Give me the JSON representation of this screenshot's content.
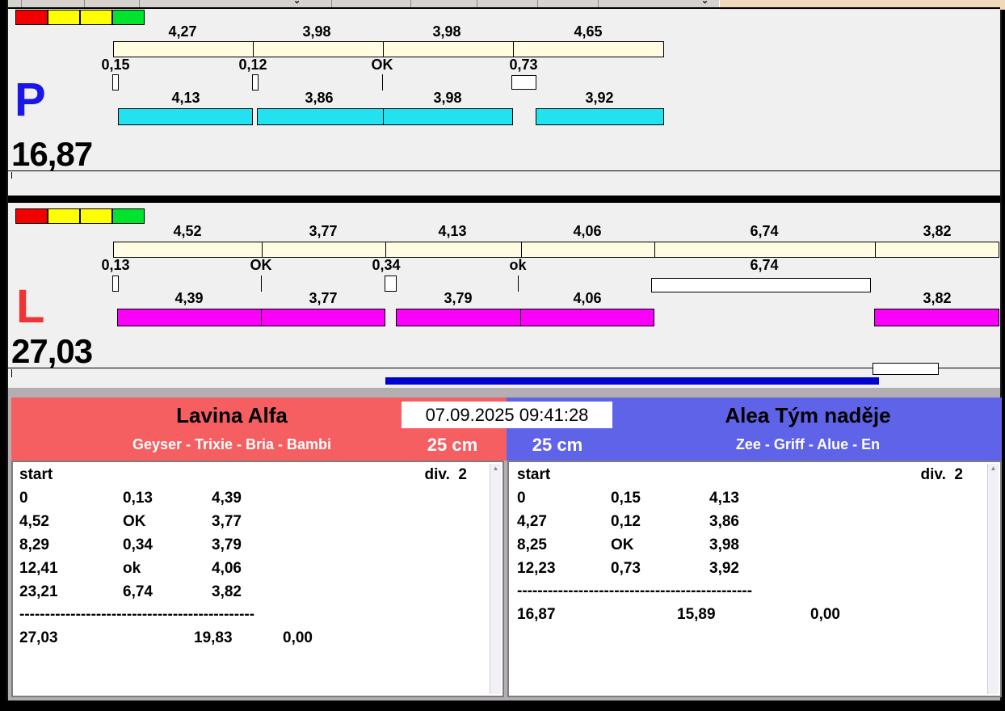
{
  "clock": "07.09.2025 09:41:28",
  "lane_p": {
    "letter": "P",
    "total": "16,87",
    "splits": [
      "4,27",
      "3,98",
      "3,98",
      "4,65"
    ],
    "crossings": [
      "0,15",
      "0,12",
      "OK",
      "0,73"
    ],
    "runs": [
      "4,13",
      "3,86",
      "3,98",
      "3,92"
    ]
  },
  "lane_l": {
    "letter": "L",
    "total": "27,03",
    "splits": [
      "4,52",
      "3,77",
      "4,13",
      "4,06",
      "6,74",
      "3,82"
    ],
    "crossings": [
      "0,13",
      "OK",
      "0,34",
      "ok",
      "6,74"
    ],
    "runs": [
      "4,39",
      "3,77",
      "3,79",
      "4,06",
      "3,82"
    ]
  },
  "left_panel": {
    "team": "Lavina Alfa",
    "dogs": "Geyser - Trixie - Bria - Bambi",
    "height": "25 cm",
    "header_left": "start",
    "header_right": "div.  2",
    "rows": [
      [
        "0",
        "0,13",
        "4,39"
      ],
      [
        "4,52",
        "OK",
        "3,77"
      ],
      [
        "8,29",
        "0,34",
        "3,79"
      ],
      [
        "12,41",
        "ok",
        "4,06"
      ],
      [
        "23,21",
        "6,74",
        "3,82"
      ]
    ],
    "separator": "----------------------------------------------",
    "totals": [
      "27,03",
      "19,83",
      "0,00"
    ]
  },
  "right_panel": {
    "team": "Alea Tým naděje",
    "dogs": "Zee - Griff - Alue - En",
    "height": "25 cm",
    "header_left": "start",
    "header_right": "div.  2",
    "rows": [
      [
        "0",
        "0,15",
        "4,13"
      ],
      [
        "4,27",
        "0,12",
        "3,86"
      ],
      [
        "8,25",
        "OK",
        "3,98"
      ],
      [
        "12,23",
        "0,73",
        "3,92"
      ]
    ],
    "separator": "----------------------------------------------",
    "totals": [
      "16,87",
      "15,89",
      "0,00"
    ]
  },
  "colors": {
    "lane_p_bar": "#22e2ef",
    "lane_l_bar": "#fa00fa",
    "split_bar": "#fffce1",
    "lane_p_letter": "#1a15e8",
    "lane_l_letter": "#ee3535",
    "left_header": "#f55f62",
    "right_header": "#5f63e8",
    "progress_bar": "#0000cf",
    "lights": [
      "#f20000",
      "#ffff00",
      "#ffff00",
      "#00e42e"
    ]
  }
}
